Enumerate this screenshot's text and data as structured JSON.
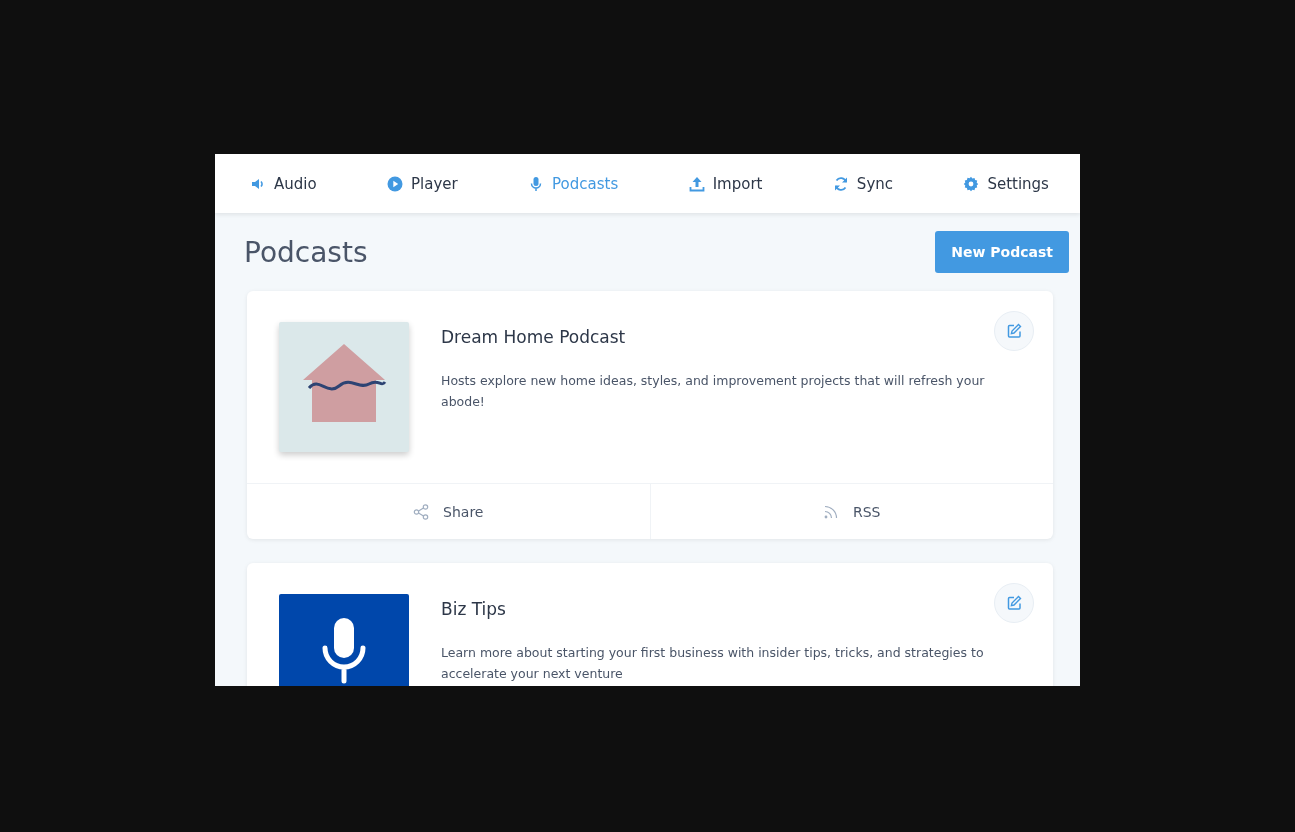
{
  "nav": {
    "tabs": [
      {
        "label": "Audio",
        "kind": "speaker",
        "selected": false
      },
      {
        "label": "Player",
        "kind": "play",
        "selected": false
      },
      {
        "label": "Podcasts",
        "kind": "mic",
        "selected": true
      },
      {
        "label": "Import",
        "kind": "upload",
        "selected": false
      },
      {
        "label": "Sync",
        "kind": "sync",
        "selected": false
      },
      {
        "label": "Settings",
        "kind": "gear",
        "selected": false
      }
    ]
  },
  "page": {
    "title": "Podcasts",
    "new_button": "New Podcast"
  },
  "podcasts": [
    {
      "kind": "house",
      "title": "Dream Home Podcast",
      "description": "Hosts explore new home ideas, styles, and improvement projects that will refresh your abode!",
      "actions": [
        {
          "kind": "share",
          "label": "Share"
        },
        {
          "kind": "rss",
          "label": "RSS"
        }
      ]
    },
    {
      "kind": "mic",
      "title": "Biz Tips",
      "description": "Learn more about starting your first business with insider tips, tricks, and strategies to accelerate your next venture"
    }
  ]
}
